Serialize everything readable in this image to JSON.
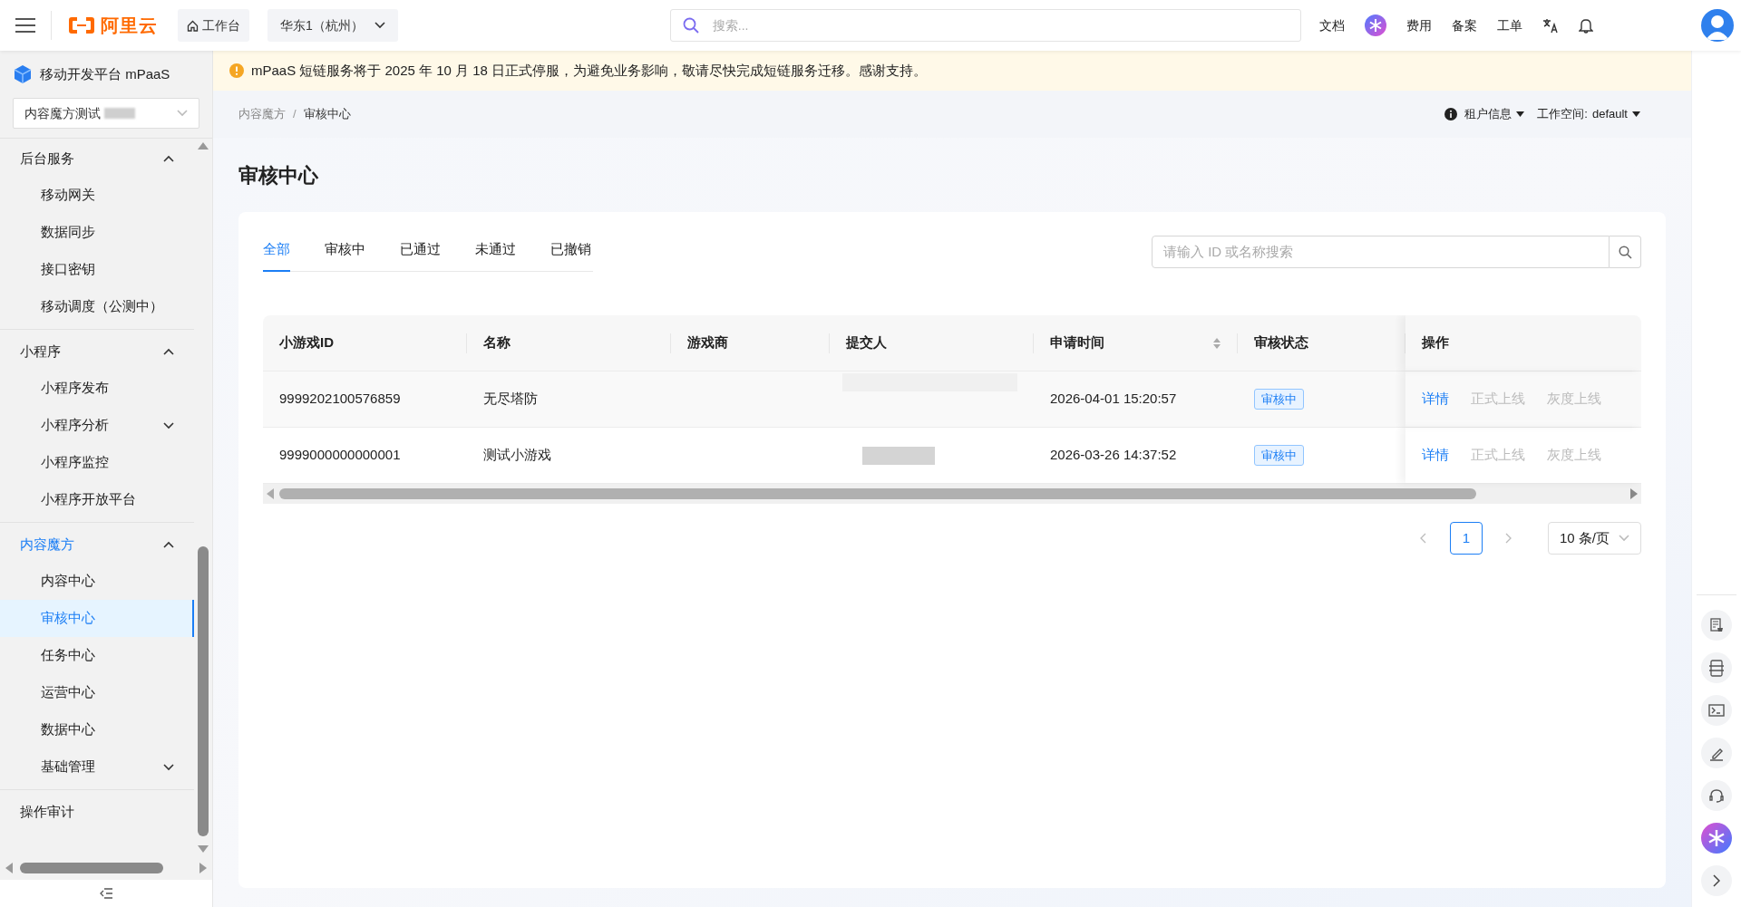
{
  "topbar": {
    "logo": "阿里云",
    "workbench": "工作台",
    "region": "华东1（杭州）",
    "search": {
      "placeholder": "搜索..."
    },
    "links": [
      {
        "kind": "text",
        "label": "文档"
      },
      {
        "kind": "ai"
      },
      {
        "kind": "text",
        "label": "费用"
      },
      {
        "kind": "text",
        "label": "备案"
      },
      {
        "kind": "text",
        "label": "工单"
      },
      {
        "kind": "translate"
      },
      {
        "kind": "bell"
      }
    ]
  },
  "notice": "mPaaS 短链服务将于 2025 年 10 月 18 日正式停服，为避免业务影响，敬请尽快完成短链服务迁移。感谢支持。",
  "breadcrumb": [
    "内容魔方",
    "审核中心"
  ],
  "breadcrumb_separator": "/",
  "header_right": {
    "tenant": "租户信息",
    "workspace_label": "工作空间:",
    "workspace": "default"
  },
  "sidebar": {
    "product": "移动开发平台 mPaaS",
    "app_select": "内容魔方测试",
    "groups": [
      {
        "label": "后台服务",
        "expanded": true,
        "selected": false,
        "items": [
          {
            "label": "移动网关",
            "kind": "link",
            "selected": false
          },
          {
            "label": "数据同步",
            "kind": "link",
            "selected": false
          },
          {
            "label": "接口密钥",
            "kind": "link",
            "selected": false
          },
          {
            "label": "移动调度（公测中）",
            "kind": "link",
            "selected": false
          }
        ]
      },
      {
        "label": "小程序",
        "expanded": true,
        "selected": false,
        "items": [
          {
            "label": "小程序发布",
            "kind": "link",
            "selected": false
          },
          {
            "label": "小程序分析",
            "kind": "submenu",
            "expanded": false,
            "selected": false
          },
          {
            "label": "小程序监控",
            "kind": "link",
            "selected": false
          },
          {
            "label": "小程序开放平台",
            "kind": "link",
            "selected": false
          }
        ]
      },
      {
        "label": "内容魔方",
        "expanded": true,
        "selected": true,
        "items": [
          {
            "label": "内容中心",
            "kind": "link",
            "selected": false
          },
          {
            "label": "审核中心",
            "kind": "link",
            "selected": true
          },
          {
            "label": "任务中心",
            "kind": "link",
            "selected": false
          },
          {
            "label": "运营中心",
            "kind": "link",
            "selected": false
          },
          {
            "label": "数据中心",
            "kind": "link",
            "selected": false
          },
          {
            "label": "基础管理",
            "kind": "submenu",
            "expanded": false,
            "selected": false
          }
        ]
      },
      {
        "label": "操作审计",
        "selected": false
      }
    ]
  },
  "page_title": "审核中心",
  "tabs": [
    {
      "label": "全部",
      "selected": true
    },
    {
      "label": "审核中",
      "selected": false
    },
    {
      "label": "已通过",
      "selected": false
    },
    {
      "label": "未通过",
      "selected": false
    },
    {
      "label": "已撤销",
      "selected": false
    }
  ],
  "search": {
    "placeholder": "请输入 ID 或名称搜索"
  },
  "table": {
    "columns": [
      {
        "label": "小游戏ID",
        "sortable": false
      },
      {
        "label": "名称",
        "sortable": false
      },
      {
        "label": "游戏商",
        "sortable": false
      },
      {
        "label": "提交人",
        "sortable": false
      },
      {
        "label": "申请时间",
        "sortable": true
      },
      {
        "label": "审核状态",
        "sortable": false
      },
      {
        "label": "操作",
        "sortable": false
      }
    ],
    "rows": [
      {
        "id": "9999202100576859",
        "name": "无尽塔防",
        "time": "2026-04-01 15:20:57",
        "status": "审核中",
        "actions": [
          {
            "label": "详情",
            "disabled": false
          },
          {
            "label": "正式上线",
            "disabled": true
          },
          {
            "label": "灰度上线",
            "disabled": true
          }
        ]
      },
      {
        "id": "9999000000000001",
        "name": "测试小游戏",
        "time": "2026-03-26 14:37:52",
        "status": "审核中",
        "actions": [
          {
            "label": "详情",
            "disabled": false
          },
          {
            "label": "正式上线",
            "disabled": true
          },
          {
            "label": "灰度上线",
            "disabled": true
          }
        ]
      }
    ]
  },
  "pagination": {
    "pages": [
      {
        "label": "1",
        "selected": true
      }
    ],
    "page_size": "10 条/页"
  }
}
